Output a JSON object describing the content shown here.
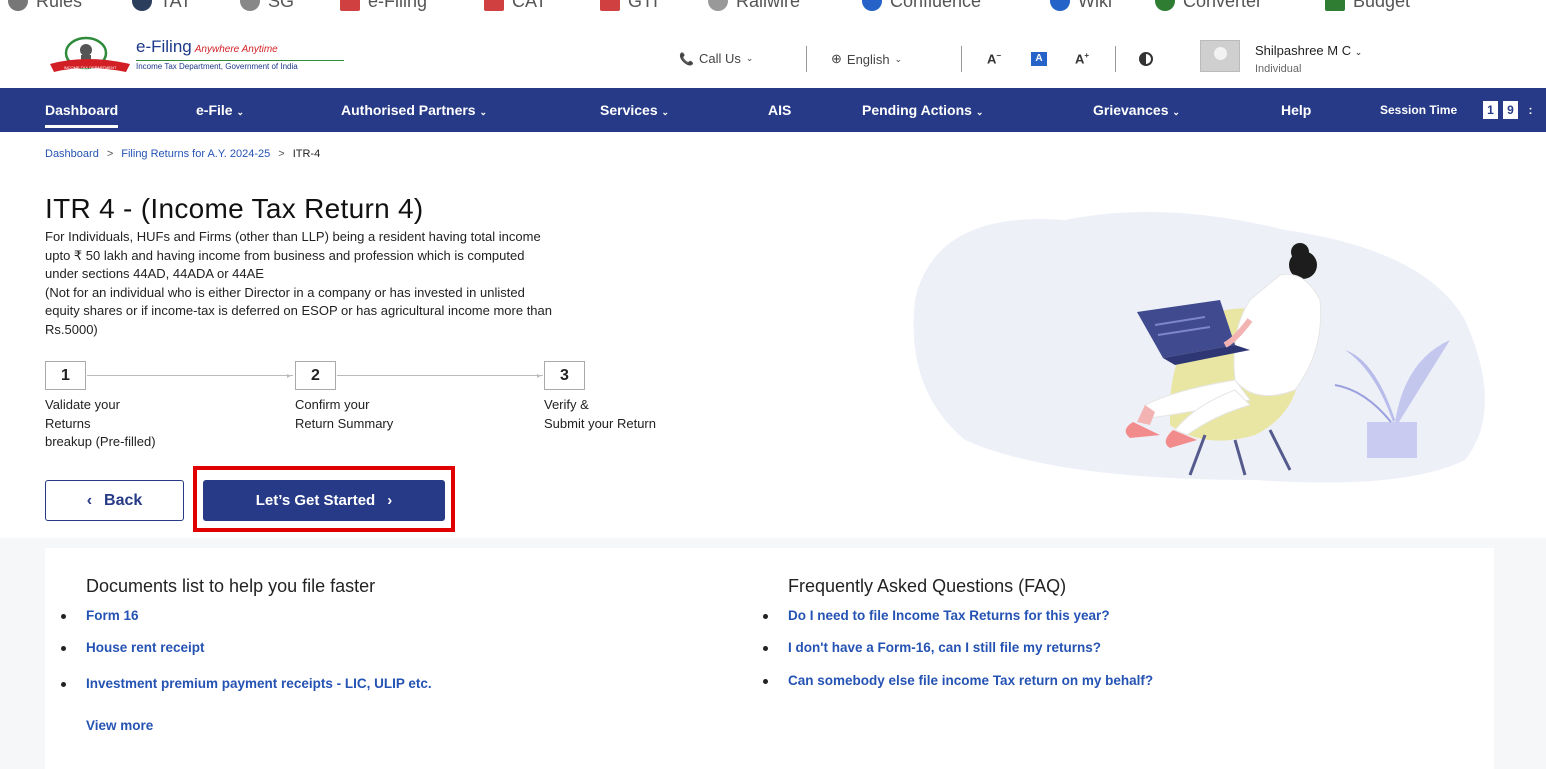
{
  "bookmarks": [
    {
      "label": "Rules",
      "color": "#777777"
    },
    {
      "label": "TAT",
      "color": "#2b3e5c"
    },
    {
      "label": "SG",
      "color": "#888888"
    },
    {
      "label": "e-Filing",
      "color": "#d04040"
    },
    {
      "label": "CAT",
      "color": "#d04040"
    },
    {
      "label": "GTI",
      "color": "#d04040"
    },
    {
      "label": "Railwire",
      "color": "#777777"
    },
    {
      "label": "Confluence",
      "color": "#2563c9"
    },
    {
      "label": "Wiki",
      "color": "#2563c9"
    },
    {
      "label": "Converter",
      "color": "#2e7d32"
    },
    {
      "label": "Budget",
      "color": "#2e7d32"
    }
  ],
  "header": {
    "logo_title": "e-Filing",
    "logo_tagline": "Anywhere Anytime",
    "logo_subtitle": "Income Tax Department, Government of India",
    "call_us": "Call Us",
    "language": "English",
    "font_decrease": "A",
    "font_normal": "A",
    "font_increase": "A",
    "contrast_icon": "contrast-icon",
    "user_name": "Shilpashree M C",
    "user_role": "Individual"
  },
  "nav": {
    "items": [
      {
        "label": "Dashboard",
        "dropdown": false
      },
      {
        "label": "e-File",
        "dropdown": true
      },
      {
        "label": "Authorised Partners",
        "dropdown": true
      },
      {
        "label": "Services",
        "dropdown": true
      },
      {
        "label": "AIS",
        "dropdown": false
      },
      {
        "label": "Pending Actions",
        "dropdown": true
      },
      {
        "label": "Grievances",
        "dropdown": true
      },
      {
        "label": "Help",
        "dropdown": false
      }
    ],
    "session_label": "Session Time",
    "session_digits": [
      "1",
      "9",
      ":"
    ]
  },
  "breadcrumb": {
    "home": "Dashboard",
    "middle": "Filing Returns for A.Y. 2024-25",
    "current": "ITR-4",
    "separator": ">"
  },
  "page": {
    "title": "ITR 4 - (Income Tax Return 4)",
    "description_lines": [
      "For Individuals, HUFs and Firms (other than LLP) being a resident having total income",
      "upto ₹ 50 lakh and having income from business and profession which is computed",
      "under sections 44AD, 44ADA or 44AE",
      "(Not for an individual who is either Director in a company or has invested in unlisted",
      "equity shares or if income-tax is deferred on ESOP or has agricultural income more than",
      "Rs.5000)"
    ]
  },
  "steps": [
    {
      "number": "1",
      "lines": [
        "Validate your",
        "Returns",
        "breakup (Pre-filled)"
      ]
    },
    {
      "number": "2",
      "lines": [
        "Confirm your",
        "Return Summary"
      ]
    },
    {
      "number": "3",
      "lines": [
        "Verify &",
        "Submit your Return"
      ]
    }
  ],
  "buttons": {
    "back_icon": "‹",
    "back_label": "Back",
    "start_label": "Let’s Get Started",
    "start_icon": "›"
  },
  "documents": {
    "title": "Documents list to help you file faster",
    "items": [
      "Form 16",
      "House rent receipt",
      "Investment premium payment receipts - LIC, ULIP etc."
    ],
    "view_more": "View more"
  },
  "faq": {
    "title": "Frequently Asked Questions (FAQ)",
    "items": [
      "Do I need to file Income Tax Returns for this year?",
      "I don't have a Form-16, can I still file my returns?",
      "Can somebody else file income Tax return on my behalf?"
    ]
  },
  "colors": {
    "nav_bg": "#263a87",
    "link": "#2553b3",
    "highlight": "#e00000"
  }
}
